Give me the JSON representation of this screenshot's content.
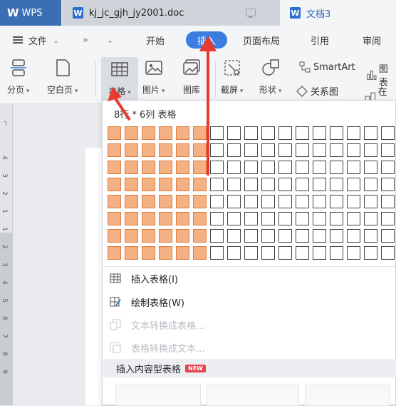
{
  "tabs": {
    "wps_label": "WPS",
    "doc_tab_label": "kj_jc_gjh_jy2001.doc",
    "new_tab_label": "文档3",
    "doc_icon_letter": "W"
  },
  "menu": {
    "file_label": "文件",
    "items": [
      "开始",
      "插入",
      "页面布局",
      "引用",
      "审阅"
    ],
    "active_label": "插入",
    "active_color": "#3b7ee0"
  },
  "ribbon": {
    "page_break_label": "分页",
    "blank_page_label": "空白页",
    "table_label": "表格",
    "picture_label": "图片",
    "gallery_label": "图库",
    "screenshot_label": "截屏",
    "shapes_label": "形状",
    "smartart_label": "SmartArt",
    "relation_label": "关系图",
    "chart_label_partial": "图表",
    "online_label_partial": "在线"
  },
  "dropdown": {
    "grid_caption": "8行 * 6列 表格",
    "grid_rows": 8,
    "grid_cols": 17,
    "selected_rows": 8,
    "selected_cols": 6,
    "selected_color": "#f4b183",
    "menu_items": [
      {
        "label": "插入表格(I)",
        "icon": "insert-table-icon",
        "disabled": false
      },
      {
        "label": "绘制表格(W)",
        "icon": "draw-table-icon",
        "disabled": false
      },
      {
        "label": "文本转换成表格...",
        "icon": "text-to-table-icon",
        "disabled": true
      },
      {
        "label": "表格转换成文本...",
        "icon": "table-to-text-icon",
        "disabled": true
      }
    ],
    "section_label": "插入内容型表格",
    "new_badge": "NEW"
  },
  "ruler": {
    "numbers": [
      "4",
      "3",
      "2",
      "1",
      "1",
      "2",
      "3",
      "4",
      "5",
      "6",
      "7",
      "8",
      "9"
    ]
  },
  "arrow_color": "#e63b2e"
}
